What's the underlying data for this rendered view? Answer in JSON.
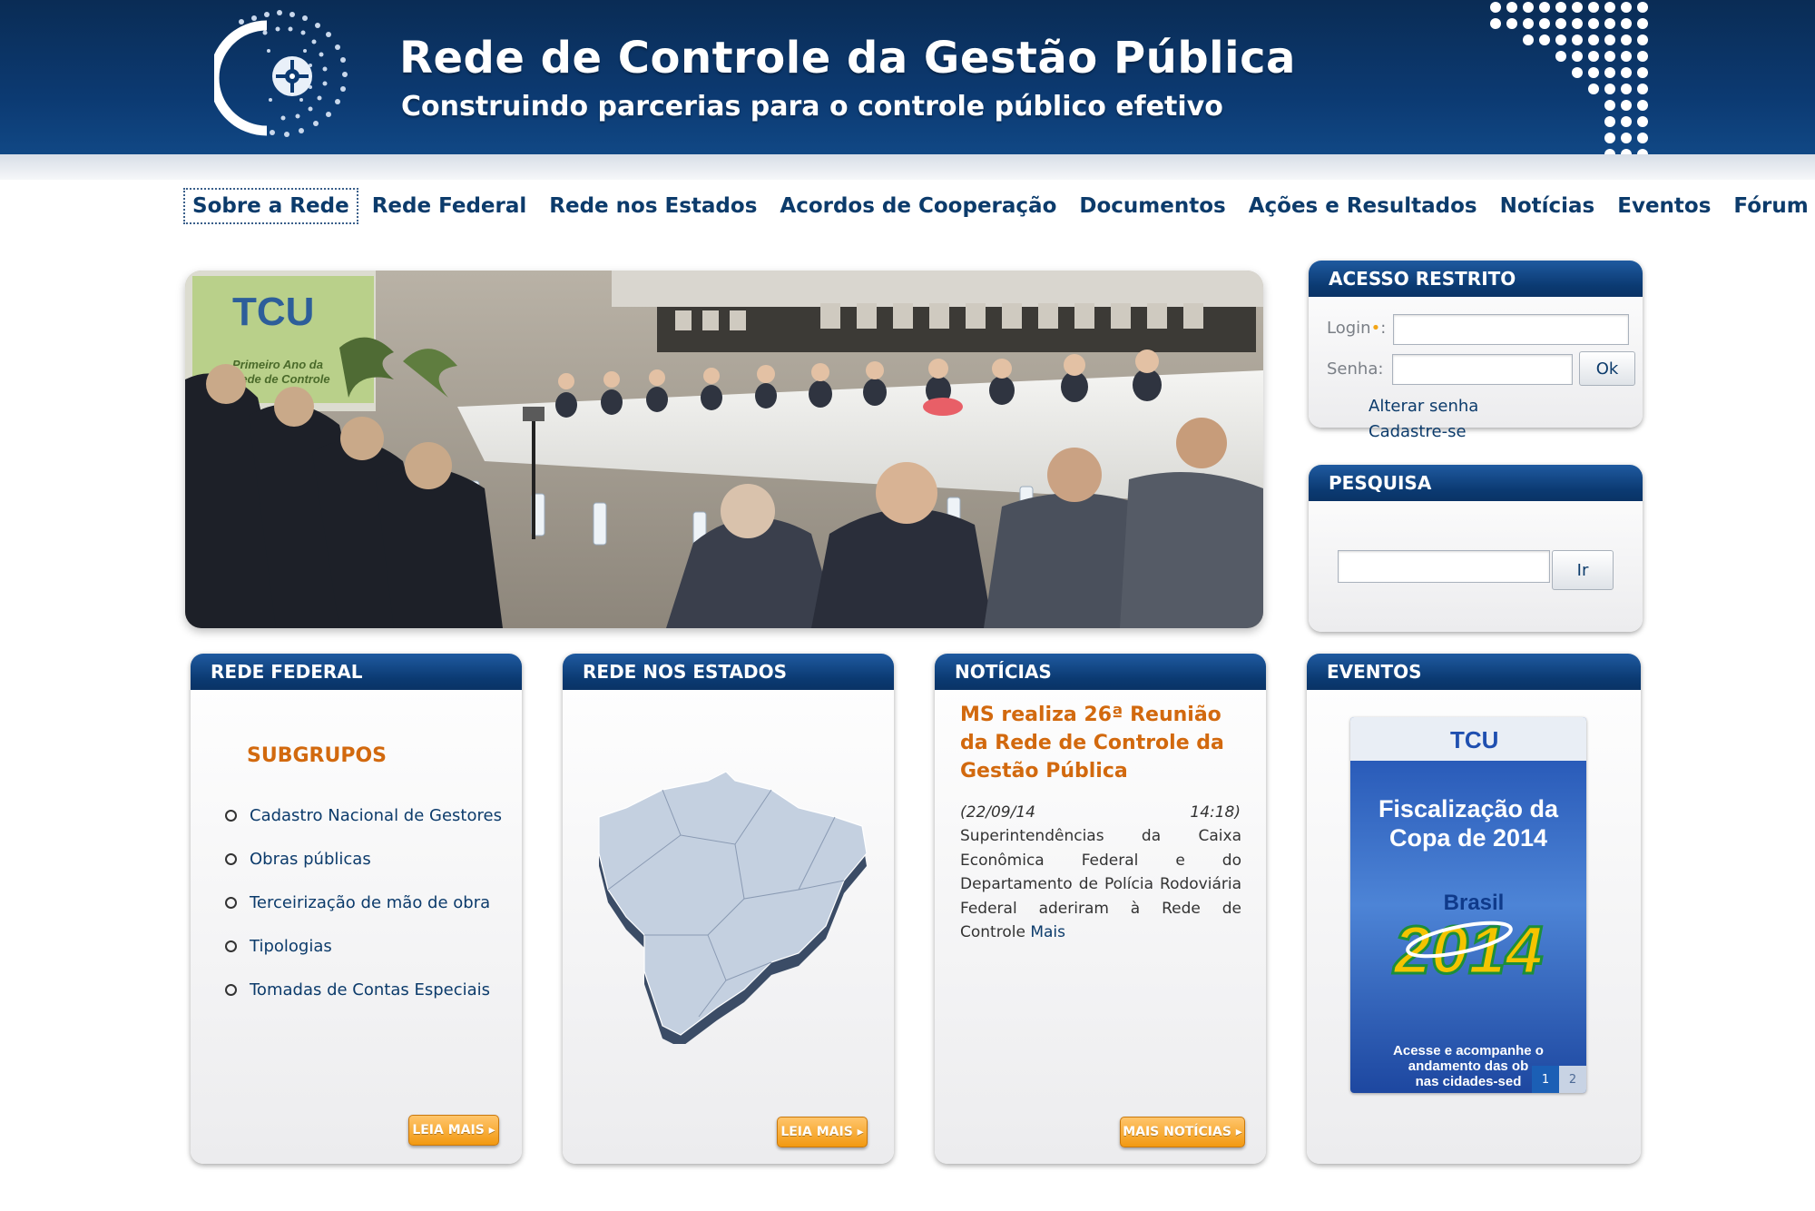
{
  "header": {
    "title": "Rede de Controle da Gestão Pública",
    "subtitle": "Construindo parcerias para o controle público efetivo"
  },
  "nav": [
    {
      "label": "Sobre a Rede"
    },
    {
      "label": "Rede Federal"
    },
    {
      "label": "Rede nos Estados"
    },
    {
      "label": "Acordos de Cooperação"
    },
    {
      "label": "Documentos"
    },
    {
      "label": "Ações e Resultados"
    },
    {
      "label": "Notícias"
    },
    {
      "label": "Eventos"
    },
    {
      "label": "Fórum"
    }
  ],
  "banner": {
    "screen_logo": "TCU",
    "screen_caption_1": "Primeiro Ano da",
    "screen_caption_2": "Rede de Controle"
  },
  "access": {
    "title": "ACESSO RESTRITO",
    "login_label": "Login",
    "password_label": "Senha:",
    "ok_label": "Ok",
    "change_password": "Alterar senha",
    "register": "Cadastre-se"
  },
  "search": {
    "title": "PESQUISA",
    "button_label": "Ir"
  },
  "federal": {
    "title": "REDE FEDERAL",
    "subheading": "SUBGRUPOS",
    "items": [
      "Cadastro Nacional de Gestores",
      "Obras públicas",
      "Terceirização de mão de obra",
      "Tipologias",
      "Tomadas de Contas Especiais"
    ],
    "more": "LEIA MAIS"
  },
  "states": {
    "title": "REDE NOS ESTADOS",
    "more": "LEIA MAIS"
  },
  "news": {
    "title": "NOTÍCIAS",
    "headline": "MS realiza 26ª Reunião da Rede de Controle da Gestão Pública",
    "date": "(22/09/14",
    "time": "14:18)",
    "body": "Superintendências da Caixa Econômica Federal e do Departamento de Polícia Rodoviária Federal aderiram à Rede de Controle",
    "more_link": "Mais",
    "more_button": "MAIS NOTÍCIAS"
  },
  "events": {
    "title": "EVENTOS",
    "card_logo": "TCU",
    "card_heading_1": "Fiscalização da",
    "card_heading_2": "Copa de 2014",
    "card_brand": "Brasil",
    "card_year": "2014",
    "card_footer_1": "Acesse e acompanhe o",
    "card_footer_2": "andamento das ob",
    "card_footer_3": "nas cidades-sed",
    "pages": [
      "1",
      "2"
    ]
  },
  "colors": {
    "navy": "#0c3b6b",
    "orange": "#d2690e",
    "header_bg": "#0a2c55"
  }
}
